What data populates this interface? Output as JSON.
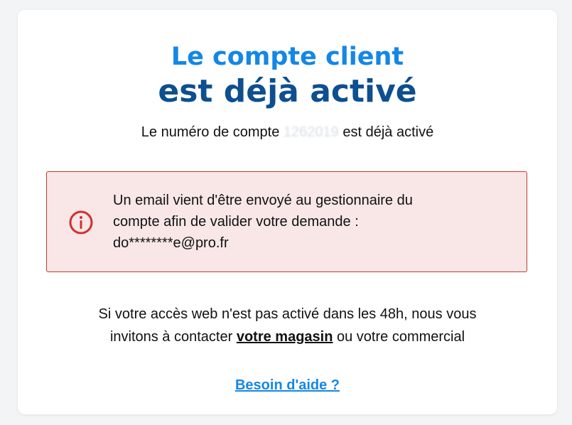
{
  "card": {
    "title_line1": "Le compte client",
    "title_line2": "est déjà activé",
    "subtitle_prefix": "Le numéro de compte",
    "account_number_masked": "1262019",
    "subtitle_suffix": "est déjà activé"
  },
  "alert": {
    "icon": "info-circle-icon",
    "line1": "Un email vient d'être envoyé au gestionnaire du",
    "line2": "compte afin de valider votre demande :",
    "email": "do********e@pro.fr"
  },
  "info": {
    "line1": "Si votre accès web n'est pas activé dans les 48h, nous vous",
    "line2_prefix": "invitons à contacter",
    "store_link": "votre magasin",
    "line2_suffix": "ou votre commercial"
  },
  "help": {
    "link": "Besoin d'aide ?"
  },
  "colors": {
    "title_primary": "#1487e6",
    "title_secondary": "#0d4f8f",
    "alert_bg": "#f9e7e7",
    "alert_border": "#c0392b",
    "alert_icon": "#d32f2f",
    "link": "#1487e6"
  }
}
